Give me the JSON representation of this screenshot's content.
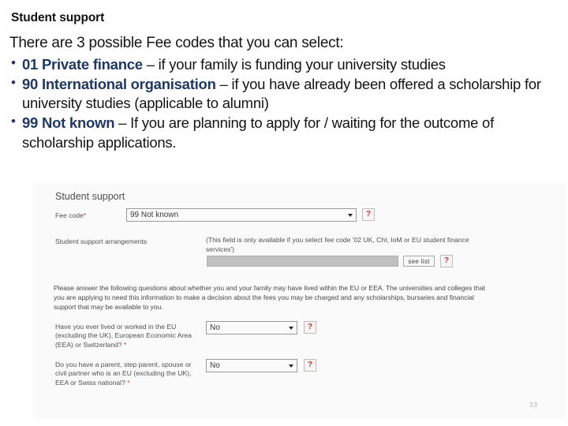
{
  "slide": {
    "title": "Student support",
    "intro": "There are 3 possible Fee codes that you can select:",
    "fee_codes": [
      {
        "code_label": "01 Private finance",
        "description": " – if your family is funding your university studies"
      },
      {
        "code_label": "90 International organisation",
        "description": " – if you have already been offered a scholarship for university studies (applicable to alumni)"
      },
      {
        "code_label": "99 Not known",
        "description": " – If you are planning to apply for / waiting for the outcome of scholarship applications."
      }
    ],
    "accent_color": "#1F3864",
    "page_number": "33"
  },
  "form": {
    "heading": "Student support",
    "fee_code": {
      "label": "Fee code",
      "required_marker": "*",
      "selected_value": "99 Not known",
      "help_label": "?"
    },
    "support_arrangements": {
      "label": "Student support arrangements",
      "hint": "(This field is only available if you select fee code '02 UK, ChI, IoM or EU student finance services')",
      "field_value": "",
      "see_list_label": "see list",
      "help_label": "?"
    },
    "paragraph": "Please answer the following questions about whether you and your family may have lived within the EU or EEA. The universities and colleges that you are applying to need this information to make a decision about the fees you may be charged and any scholarships, bursaries and financial support that may be available to you.",
    "questions": [
      {
        "label": "Have you ever lived or worked in the EU (excluding the UK), European Economic Area (EEA) or Switzerland?",
        "required_marker": "*",
        "selected_value": "No",
        "help_label": "?"
      },
      {
        "label": "Do you have a parent, step parent, spouse or civil partner who is an EU (excluding the UK), EEA or Swiss national?",
        "required_marker": "*",
        "selected_value": "No",
        "help_label": "?"
      }
    ]
  }
}
